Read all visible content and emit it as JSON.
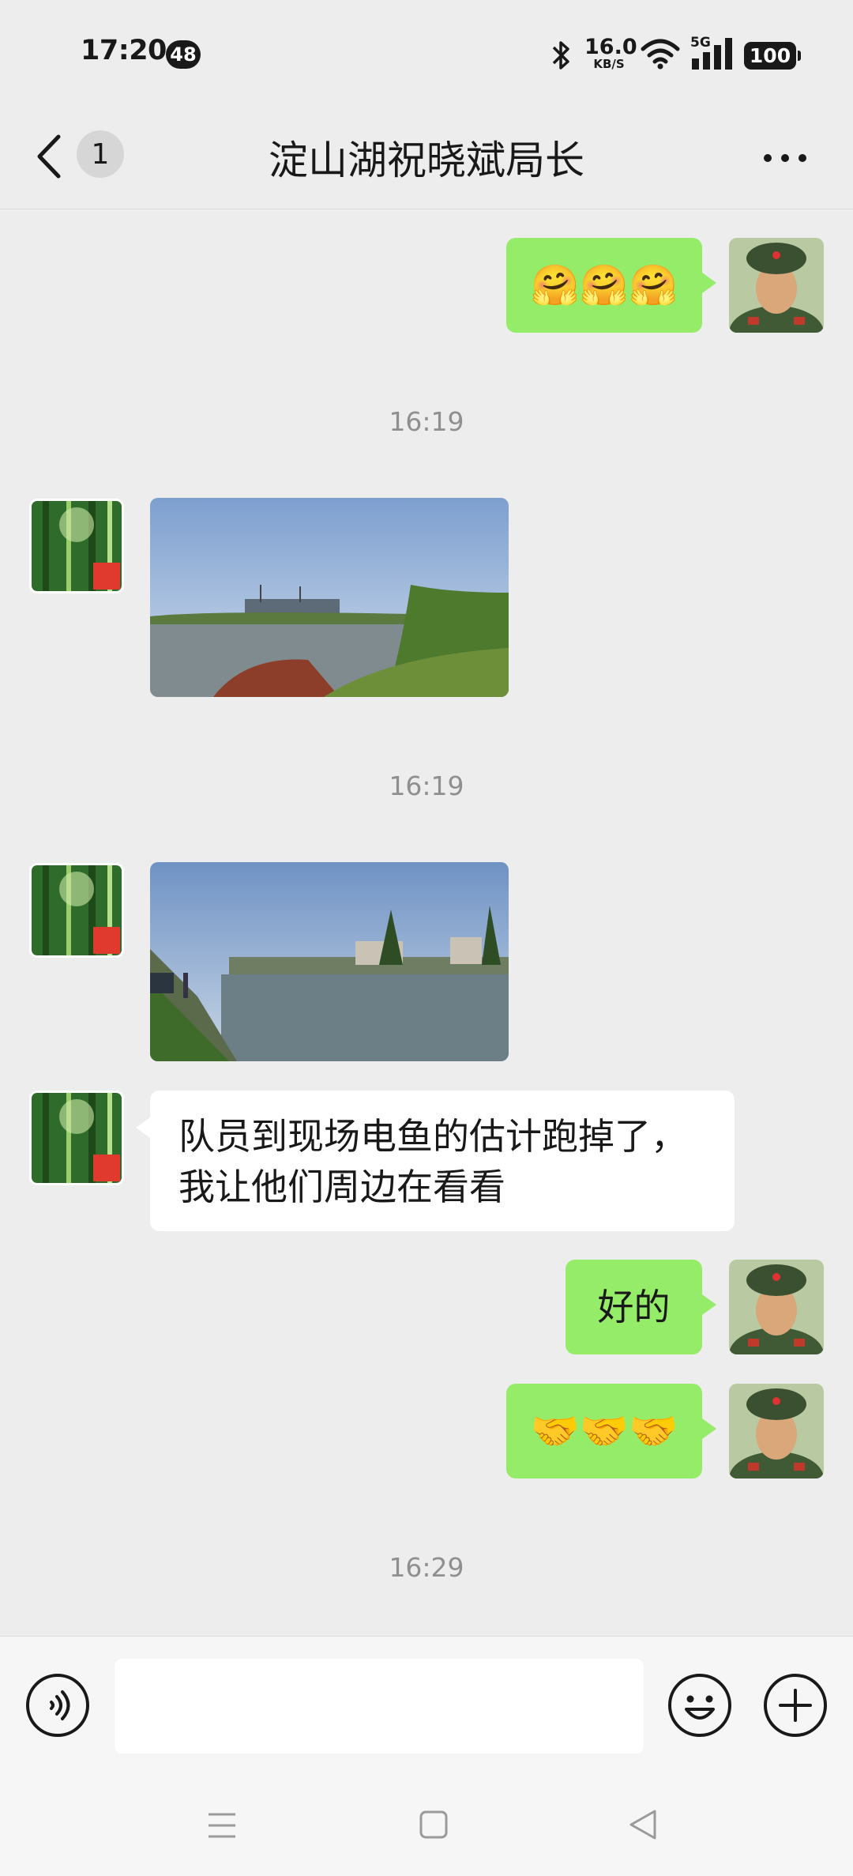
{
  "status_bar": {
    "time": "17:20",
    "notification_count": "48",
    "net_speed_value": "16.0",
    "net_speed_unit": "KB/S",
    "network_type": "5G",
    "battery": "100"
  },
  "header": {
    "back_label": "back-icon",
    "unread_count": "1",
    "title": "淀山湖祝晓斌局长",
    "more_label": "more-icon"
  },
  "messages": [
    {
      "type": "emoji",
      "sender": "me",
      "content": "🤗🤗🤗"
    },
    {
      "type": "timestamp",
      "text": "16:19"
    },
    {
      "type": "image",
      "sender": "other",
      "description_icon": "photo-river-construction"
    },
    {
      "type": "timestamp",
      "text": "16:19"
    },
    {
      "type": "image",
      "sender": "other",
      "description_icon": "photo-river-village"
    },
    {
      "type": "text",
      "sender": "other",
      "line1": "队员到现场电鱼的估计跑掉了，",
      "line2": "我让他们周边在看看"
    },
    {
      "type": "text",
      "sender": "me",
      "content": "好的"
    },
    {
      "type": "emoji",
      "sender": "me",
      "content": "🤝🤝🤝"
    },
    {
      "type": "timestamp",
      "text": "16:29"
    }
  ],
  "input_bar": {
    "input_value": "",
    "voice_icon": "voice-icon",
    "emoji_icon": "emoji-icon",
    "plus_icon": "plus-icon"
  },
  "colors": {
    "my_bubble": "#95ec69",
    "other_bubble": "#ffffff",
    "background": "#ededed"
  }
}
